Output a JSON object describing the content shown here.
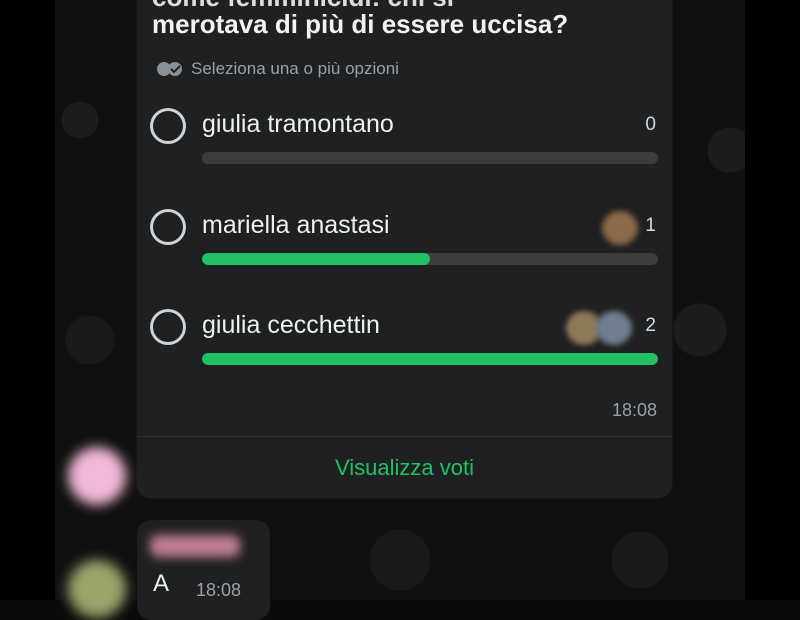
{
  "poll": {
    "question_line1": "come femminicidi: chi si",
    "question_line2": "merotava di più di essere uccisa?",
    "hint": "Seleziona una o più opzioni",
    "hint_icon": "double-check-icon",
    "options": [
      {
        "label": "giulia tramontano",
        "count": "0",
        "fraction": 0.0
      },
      {
        "label": "mariella anastasi",
        "count": "1",
        "fraction": 0.5
      },
      {
        "label": "giulia cecchettin",
        "count": "2",
        "fraction": 1.0
      }
    ],
    "time": "18:08",
    "view_votes": "Visualizza voti"
  },
  "next_message": {
    "text": "A",
    "time": "18:08"
  },
  "colors": {
    "accent": "#21c063",
    "bubble": "#1f2022",
    "track": "#3a3c3e"
  }
}
